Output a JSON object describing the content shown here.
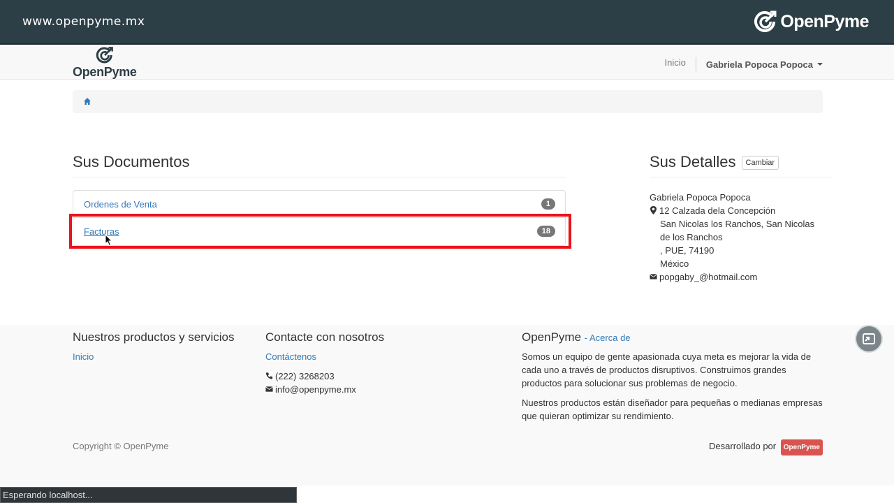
{
  "banner": {
    "url": "www.openpyme.mx",
    "brand": "OpenPyme"
  },
  "navbar": {
    "brand": "OpenPyme",
    "inicio": "Inicio",
    "user": "Gabriela Popoca Popoca"
  },
  "documents": {
    "title": "Sus Documentos",
    "items": [
      {
        "label": "Ordenes de Venta",
        "count": "1"
      },
      {
        "label": "Facturas",
        "count": "18"
      }
    ]
  },
  "details": {
    "title": "Sus Detalles",
    "change_button": "Cambiar",
    "name": "Gabriela Popoca Popoca",
    "street": "12 Calzada dela Concepción",
    "colony": "San Nicolas los Ranchos, San Nicolas de los Ranchos",
    "state": ", PUE, 74190",
    "country": "México",
    "email": "popgaby_@hotmail.com"
  },
  "footer": {
    "products_title": "Nuestros productos y servicios",
    "products_link": "Inicio",
    "contact_title": "Contacte con nosotros",
    "contact_link": "Contáctenos",
    "phone": "(222) 3268203",
    "email": "info@openpyme.mx",
    "about_title": "OpenPyme",
    "about_link": "- Acerca de",
    "about_p1": "Somos un equipo de gente apasionada cuya meta es mejorar la vida de cada uno a través de productos disruptivos. Construimos grandes productos para solucionar sus problemas de negocio.",
    "about_p2": "Nuestros productos están diseñador para pequeñas o medianas empresas que quieran optimizar su rendimiento.",
    "copyright": "Copyright © OpenPyme",
    "developed_by": "Desarrollado por",
    "developed_badge": "OpenPyme"
  },
  "status": {
    "text": "Esperando localhost..."
  },
  "colors": {
    "link": "#337ab7",
    "highlight": "#e8131c",
    "banner": "#2c3e46",
    "badge": "#777777"
  }
}
